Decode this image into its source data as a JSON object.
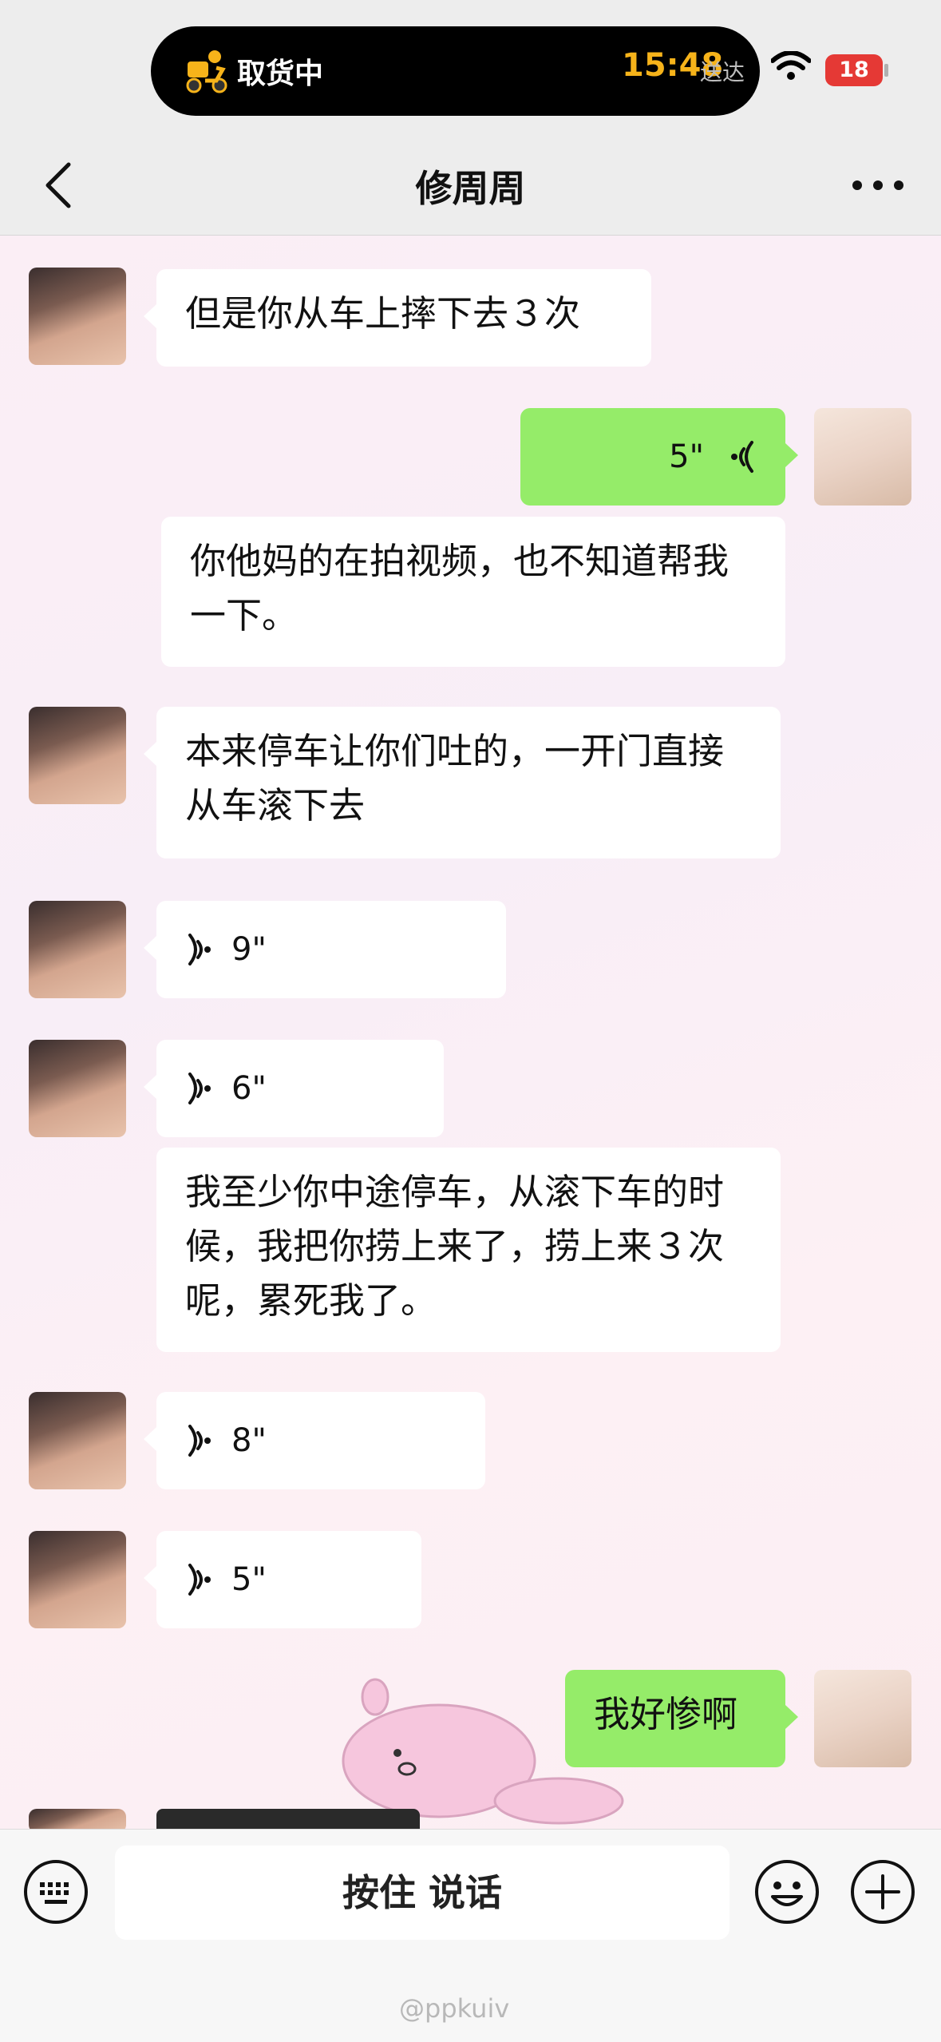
{
  "status_bar": {
    "activity_label": "取货中",
    "activity_time": "15:48",
    "activity_sub": "送达",
    "battery": "18"
  },
  "nav": {
    "title": "修周周"
  },
  "messages": [
    {
      "side": "left",
      "type": "text",
      "text": "但是你从车上摔下去３次"
    },
    {
      "side": "right",
      "type": "voice",
      "duration": "5\""
    },
    {
      "side": "right",
      "type": "transcript",
      "text": "你他妈的在拍视频，也不知道帮我一下。"
    },
    {
      "side": "left",
      "type": "text",
      "text": "本来停车让你们吐的，一开门直接从车滚下去"
    },
    {
      "side": "left",
      "type": "voice",
      "duration": "9\""
    },
    {
      "side": "left",
      "type": "voice",
      "duration": "6\""
    },
    {
      "side": "left",
      "type": "transcript",
      "text": "我至少你中途停车，从滚下车的时候，我把你捞上来了，捞上来３次呢，累死我了。"
    },
    {
      "side": "left",
      "type": "voice",
      "duration": "8\""
    },
    {
      "side": "left",
      "type": "voice",
      "duration": "5\""
    },
    {
      "side": "right",
      "type": "text",
      "text": "我好惨啊"
    }
  ],
  "input_bar": {
    "hold_to_talk": "按住 说话"
  },
  "watermark": "@ppkuiv",
  "colors": {
    "sent_bubble": "#95ec69",
    "received_bubble": "#ffffff",
    "island_time": "#f6b31a",
    "battery_low": "#e53935"
  }
}
